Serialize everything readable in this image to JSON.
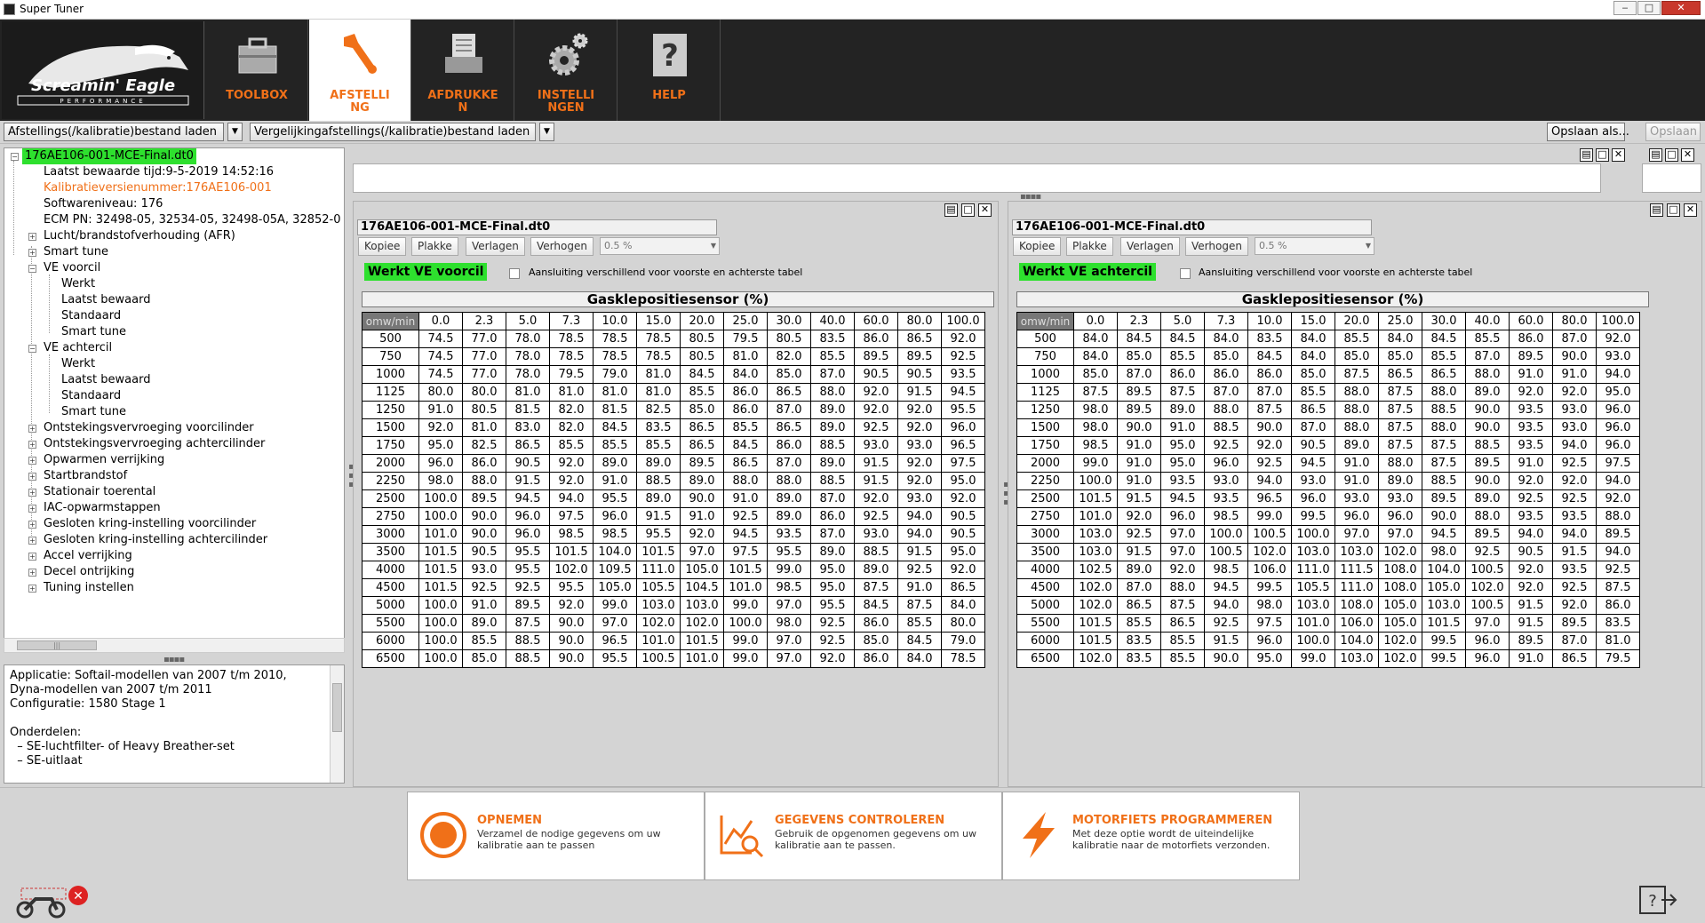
{
  "window": {
    "title": "Super Tuner",
    "minimize": "‒",
    "maximize": "□",
    "close": "✕"
  },
  "toolbar": {
    "logo_text": "Screamin' Eagle",
    "logo_sub": "PERFORMANCE",
    "items": [
      {
        "label": "TOOLBOX"
      },
      {
        "label": "AFSTELLI\nNG"
      },
      {
        "label": "AFDRUKKE\nN"
      },
      {
        "label": "INSTELLI\nNGEN"
      },
      {
        "label": "HELP"
      }
    ]
  },
  "filebar": {
    "load_cal": "Afstellings(/kalibratie)bestand laden",
    "load_compare": "Vergelijkingafstellings(/kalibratie)bestand laden",
    "save_as": "Opslaan als...",
    "save": "Opslaan"
  },
  "tree": {
    "root": "176AE106-001-MCE-Final.dt0",
    "nodes": [
      {
        "text": "Laatst bewaarde tijd:9-5-2019 14:52:16"
      },
      {
        "text": "Kalibratieversienummer:176AE106-001"
      },
      {
        "text": "Softwareniveau: 176"
      },
      {
        "text": "ECM PN: 32498-05, 32534-05, 32498-05A, 32852-0"
      },
      {
        "text": "Lucht/brandstofverhouding (AFR)"
      },
      {
        "text": "Smart tune"
      },
      {
        "text": "VE voorcil"
      },
      {
        "text": "Werkt"
      },
      {
        "text": "Laatst bewaard"
      },
      {
        "text": "Standaard"
      },
      {
        "text": "Smart tune"
      },
      {
        "text": "VE achtercil"
      },
      {
        "text": "Werkt"
      },
      {
        "text": "Laatst bewaard"
      },
      {
        "text": "Standaard"
      },
      {
        "text": "Smart tune"
      },
      {
        "text": "Ontstekingsvervroeging voorcilinder"
      },
      {
        "text": "Ontstekingsvervroeging achtercilinder"
      },
      {
        "text": "Opwarmen verrijking"
      },
      {
        "text": "Startbrandstof"
      },
      {
        "text": "Stationair toerental"
      },
      {
        "text": "IAC-opwarmstappen"
      },
      {
        "text": "Gesloten kring-instelling voorcilinder"
      },
      {
        "text": "Gesloten kring-instelling achtercilinder"
      },
      {
        "text": "Accel verrijking"
      },
      {
        "text": "Decel ontrijking"
      },
      {
        "text": "Tuning instellen"
      }
    ],
    "scroll_thumb": "|||"
  },
  "info": {
    "lines": [
      "Applicatie: Softail-modellen van 2007 t/m 2010,",
      "Dyna-modellen van 2007 t/m 2011",
      "Configuratie: 1580 Stage 1",
      "",
      "Onderdelen:",
      "  – SE-luchtfilter- of Heavy Breather-set",
      "  – SE-uitlaat"
    ]
  },
  "panel_buttons": {
    "restore": "▤",
    "max": "□",
    "close": "✕"
  },
  "tables": {
    "x_header": "Gasklepositiesensor (%)",
    "corner": "omw/min",
    "tps": [
      "0.0",
      "2.3",
      "5.0",
      "7.3",
      "10.0",
      "15.0",
      "20.0",
      "25.0",
      "30.0",
      "40.0",
      "60.0",
      "80.0",
      "100.0"
    ],
    "rpm": [
      "500",
      "750",
      "1000",
      "1125",
      "1250",
      "1500",
      "1750",
      "2000",
      "2250",
      "2500",
      "2750",
      "3000",
      "3500",
      "4000",
      "4500",
      "5000",
      "5500",
      "6000",
      "6500"
    ],
    "buttons": {
      "copy": "Kopiee",
      "paste": "Plakke",
      "lower": "Verlagen",
      "raise": "Verhogen",
      "step": "0.5 %",
      "step_arrow": "▼"
    },
    "link_label": "Aansluiting verschillend voor voorste en achterste tabel",
    "tag_werkt": "Werkt",
    "front": {
      "title": "176AE106-001-MCE-Final.dt0",
      "tag": "VE voorcil",
      "values": [
        [
          "74.5",
          "77.0",
          "78.0",
          "78.5",
          "78.5",
          "78.5",
          "80.5",
          "79.5",
          "80.5",
          "83.5",
          "86.0",
          "86.5",
          "92.0"
        ],
        [
          "74.5",
          "77.0",
          "78.0",
          "78.5",
          "78.5",
          "78.5",
          "80.5",
          "81.0",
          "82.0",
          "85.5",
          "89.5",
          "89.5",
          "92.5"
        ],
        [
          "74.5",
          "77.0",
          "78.0",
          "79.5",
          "79.0",
          "81.0",
          "84.5",
          "84.0",
          "85.0",
          "87.0",
          "90.5",
          "90.5",
          "93.5"
        ],
        [
          "80.0",
          "80.0",
          "81.0",
          "81.0",
          "81.0",
          "81.0",
          "85.5",
          "86.0",
          "86.5",
          "88.0",
          "92.0",
          "91.5",
          "94.5"
        ],
        [
          "91.0",
          "80.5",
          "81.5",
          "82.0",
          "81.5",
          "82.5",
          "85.0",
          "86.0",
          "87.0",
          "89.0",
          "92.0",
          "92.0",
          "95.5"
        ],
        [
          "92.0",
          "81.0",
          "83.0",
          "82.0",
          "84.5",
          "83.5",
          "86.5",
          "85.5",
          "86.5",
          "89.0",
          "92.5",
          "92.0",
          "96.0"
        ],
        [
          "95.0",
          "82.5",
          "86.5",
          "85.5",
          "85.5",
          "85.5",
          "86.5",
          "84.5",
          "86.0",
          "88.5",
          "93.0",
          "93.0",
          "96.5"
        ],
        [
          "96.0",
          "86.0",
          "90.5",
          "92.0",
          "89.0",
          "89.0",
          "89.5",
          "86.5",
          "87.0",
          "89.0",
          "91.5",
          "92.0",
          "97.5"
        ],
        [
          "98.0",
          "88.0",
          "91.5",
          "92.0",
          "91.0",
          "88.5",
          "89.0",
          "88.0",
          "88.0",
          "88.5",
          "91.5",
          "92.0",
          "95.0"
        ],
        [
          "100.0",
          "89.5",
          "94.5",
          "94.0",
          "95.5",
          "89.0",
          "90.0",
          "91.0",
          "89.0",
          "87.0",
          "92.0",
          "93.0",
          "92.0"
        ],
        [
          "100.0",
          "90.0",
          "96.0",
          "97.5",
          "96.0",
          "91.5",
          "91.0",
          "92.5",
          "89.0",
          "86.0",
          "92.5",
          "94.0",
          "90.5"
        ],
        [
          "101.0",
          "90.0",
          "96.0",
          "98.5",
          "98.5",
          "95.5",
          "92.0",
          "94.5",
          "93.5",
          "87.0",
          "93.0",
          "94.0",
          "90.5"
        ],
        [
          "101.5",
          "90.5",
          "95.5",
          "101.5",
          "104.0",
          "101.5",
          "97.0",
          "97.5",
          "95.5",
          "89.0",
          "88.5",
          "91.5",
          "95.0"
        ],
        [
          "101.5",
          "93.0",
          "95.5",
          "102.0",
          "109.5",
          "111.0",
          "105.0",
          "101.5",
          "99.0",
          "95.0",
          "89.0",
          "92.5",
          "92.0"
        ],
        [
          "101.5",
          "92.5",
          "92.5",
          "95.5",
          "105.0",
          "105.5",
          "104.5",
          "101.0",
          "98.5",
          "95.0",
          "87.5",
          "91.0",
          "86.5"
        ],
        [
          "100.0",
          "91.0",
          "89.5",
          "92.0",
          "99.0",
          "103.0",
          "103.0",
          "99.0",
          "97.0",
          "95.5",
          "84.5",
          "87.5",
          "84.0"
        ],
        [
          "100.0",
          "89.0",
          "87.5",
          "90.0",
          "97.0",
          "102.0",
          "102.0",
          "100.0",
          "98.0",
          "92.5",
          "86.0",
          "85.5",
          "80.0"
        ],
        [
          "100.0",
          "85.5",
          "88.5",
          "90.0",
          "96.5",
          "101.0",
          "101.5",
          "99.0",
          "97.0",
          "92.5",
          "85.0",
          "84.5",
          "79.0"
        ],
        [
          "100.0",
          "85.0",
          "88.5",
          "90.0",
          "95.5",
          "100.5",
          "101.0",
          "99.0",
          "97.0",
          "92.0",
          "86.0",
          "84.0",
          "78.5"
        ]
      ]
    },
    "rear": {
      "title": "176AE106-001-MCE-Final.dt0",
      "tag": "VE achtercil",
      "values": [
        [
          "84.0",
          "84.5",
          "84.5",
          "84.0",
          "83.5",
          "84.0",
          "85.5",
          "84.0",
          "84.5",
          "85.5",
          "86.0",
          "87.0",
          "92.0"
        ],
        [
          "84.0",
          "85.0",
          "85.5",
          "85.0",
          "84.5",
          "84.0",
          "85.0",
          "85.0",
          "85.5",
          "87.0",
          "89.5",
          "90.0",
          "93.0"
        ],
        [
          "85.0",
          "87.0",
          "86.0",
          "86.0",
          "86.0",
          "85.0",
          "87.5",
          "86.5",
          "86.5",
          "88.0",
          "91.0",
          "91.0",
          "94.0"
        ],
        [
          "87.5",
          "89.5",
          "87.5",
          "87.0",
          "87.0",
          "85.5",
          "88.0",
          "87.5",
          "88.0",
          "89.0",
          "92.0",
          "92.0",
          "95.0"
        ],
        [
          "98.0",
          "89.5",
          "89.0",
          "88.0",
          "87.5",
          "86.5",
          "88.0",
          "87.5",
          "88.5",
          "90.0",
          "93.5",
          "93.0",
          "96.0"
        ],
        [
          "98.0",
          "90.0",
          "91.0",
          "88.5",
          "90.0",
          "87.0",
          "88.0",
          "87.5",
          "88.0",
          "90.0",
          "93.5",
          "93.0",
          "96.0"
        ],
        [
          "98.5",
          "91.0",
          "95.0",
          "92.5",
          "92.0",
          "90.5",
          "89.0",
          "87.5",
          "87.5",
          "88.5",
          "93.5",
          "94.0",
          "96.0"
        ],
        [
          "99.0",
          "91.0",
          "95.0",
          "96.0",
          "92.5",
          "94.5",
          "91.0",
          "88.0",
          "87.5",
          "89.5",
          "91.0",
          "92.5",
          "97.5"
        ],
        [
          "100.0",
          "91.0",
          "93.5",
          "93.0",
          "94.0",
          "93.0",
          "91.0",
          "89.0",
          "88.5",
          "90.0",
          "92.0",
          "92.0",
          "94.0"
        ],
        [
          "101.5",
          "91.5",
          "94.5",
          "93.5",
          "96.5",
          "96.0",
          "93.0",
          "93.0",
          "89.5",
          "89.0",
          "92.5",
          "92.5",
          "92.0"
        ],
        [
          "101.0",
          "92.0",
          "96.0",
          "98.5",
          "99.0",
          "99.5",
          "96.0",
          "96.0",
          "90.0",
          "88.0",
          "93.5",
          "93.5",
          "88.0"
        ],
        [
          "103.0",
          "92.5",
          "97.0",
          "100.0",
          "100.5",
          "100.0",
          "97.0",
          "97.0",
          "94.5",
          "89.5",
          "94.0",
          "94.0",
          "89.5"
        ],
        [
          "103.0",
          "91.5",
          "97.0",
          "100.5",
          "102.0",
          "103.0",
          "103.0",
          "102.0",
          "98.0",
          "92.5",
          "90.5",
          "91.5",
          "94.0"
        ],
        [
          "102.5",
          "89.0",
          "92.0",
          "98.5",
          "106.0",
          "111.0",
          "111.5",
          "108.0",
          "104.0",
          "100.5",
          "92.0",
          "93.5",
          "92.5"
        ],
        [
          "102.0",
          "87.0",
          "88.0",
          "94.5",
          "99.5",
          "105.5",
          "111.0",
          "108.0",
          "105.0",
          "102.0",
          "92.0",
          "92.5",
          "87.5"
        ],
        [
          "102.0",
          "86.5",
          "87.5",
          "94.0",
          "98.0",
          "103.0",
          "108.0",
          "105.0",
          "103.0",
          "100.5",
          "91.5",
          "92.0",
          "86.0"
        ],
        [
          "101.5",
          "85.5",
          "86.5",
          "92.5",
          "97.5",
          "101.0",
          "106.0",
          "105.0",
          "101.5",
          "97.0",
          "91.5",
          "89.5",
          "83.5"
        ],
        [
          "101.5",
          "83.5",
          "85.5",
          "91.5",
          "96.0",
          "100.0",
          "104.0",
          "102.0",
          "99.5",
          "96.0",
          "89.5",
          "87.0",
          "81.0"
        ],
        [
          "102.0",
          "83.5",
          "85.5",
          "90.0",
          "95.0",
          "99.0",
          "103.0",
          "102.0",
          "99.5",
          "96.0",
          "91.0",
          "86.5",
          "79.5"
        ]
      ]
    }
  },
  "actions": [
    {
      "title": "OPNEMEN",
      "desc": "Verzamel de nodige gegevens om uw kalibratie aan te passen"
    },
    {
      "title": "GEGEVENS CONTROLEREN",
      "desc": "Gebruik de opgenomen gegevens om uw kalibratie aan te passen."
    },
    {
      "title": "MOTORFIETS PROGRAMMEREN",
      "desc": "Met deze optie wordt de uiteindelijke kalibratie naar de motorfiets verzonden."
    }
  ],
  "colors": {
    "accent": "#f07018",
    "highlight": "#2ee02e",
    "toolbar": "#232323"
  }
}
